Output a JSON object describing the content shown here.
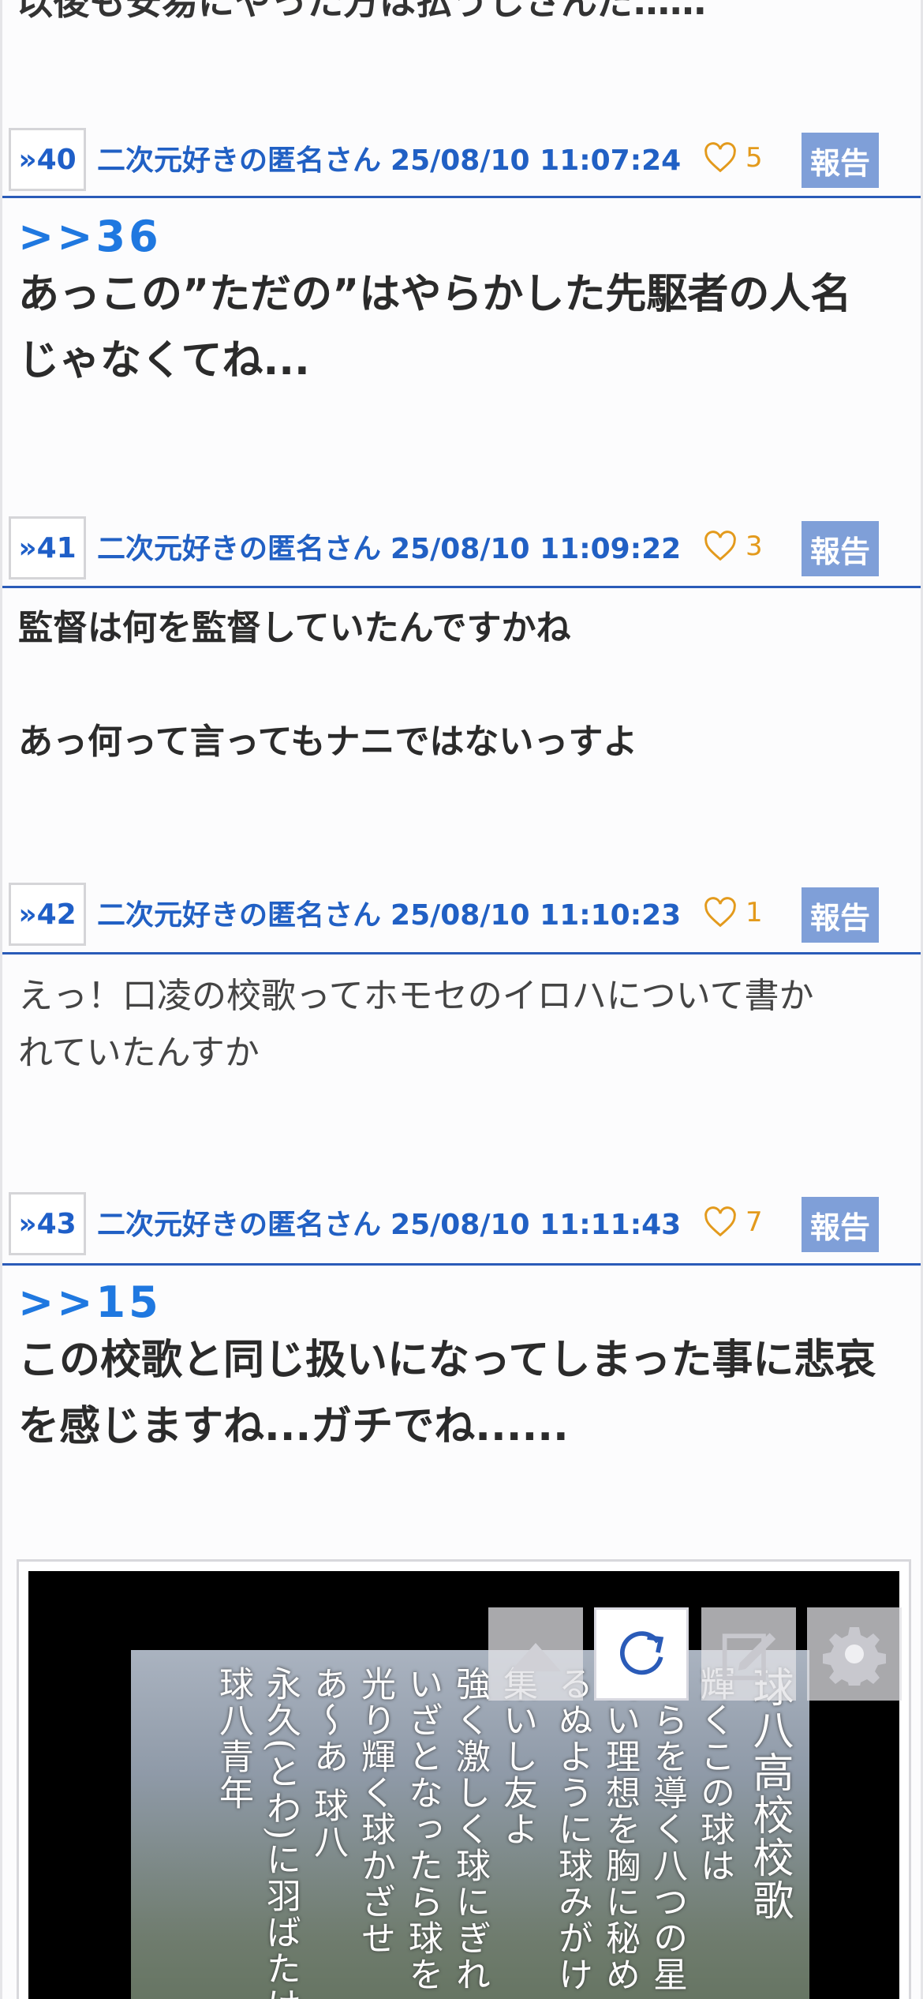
{
  "top_fragment": "以後も安易にやった方は払うしさんだ……",
  "posts": [
    {
      "num": "»40",
      "author": "二次元好きの匿名さん",
      "date": "25/08/10 11:07:24",
      "likes": "5",
      "report": "報告",
      "anchor": ">>36",
      "lines": [
        "あっこの”ただの”はやらかした先駆者の人名",
        "じゃなくてね..."
      ]
    },
    {
      "num": "»41",
      "author": "二次元好きの匿名さん",
      "date": "25/08/10 11:09:22",
      "likes": "3",
      "report": "報告",
      "lines": [
        "監督は何を監督していたんですかね",
        "",
        "あっ何って言ってもナニではないっすよ"
      ]
    },
    {
      "num": "»42",
      "author": "二次元好きの匿名さん",
      "date": "25/08/10 11:10:23",
      "likes": "1",
      "report": "報告",
      "lines": [
        "えっ！口凌の校歌ってホモセのイロハについて書か",
        "れていたんすか"
      ]
    },
    {
      "num": "»43",
      "author": "二次元好きの匿名さん",
      "date": "25/08/10 11:11:43",
      "likes": "7",
      "report": "報告",
      "anchor": ">>15",
      "lines": [
        "この校歌と同じ扱いになってしまった事に悲哀",
        "を感じますね...ガチでね......"
      ]
    }
  ],
  "image": {
    "columns": [
      "球八高校校歌",
      "輝くこの球は",
      "れらを導く八つの星",
      "高い理想を胸に秘め",
      "るぬように球みがけ",
      "集いし友よ",
      "強く激しく球にぎれ",
      "いざとなったら球を",
      "光り輝く球かざせ",
      "あ〜あ 球八",
      "永久(とわ)に羽ばたけ",
      "球八青年"
    ]
  },
  "toolbar": {
    "up_icon": "arrow-up-icon",
    "reload_icon": "reload-icon",
    "edit_icon": "edit-icon",
    "settings_icon": "gear-icon"
  },
  "colors": {
    "link_blue": "#2160c4",
    "anchor_blue": "#1f78e0",
    "like_orange": "#e39a1c",
    "report_bg": "#7f9fd8",
    "divider": "#2a5bb8"
  }
}
